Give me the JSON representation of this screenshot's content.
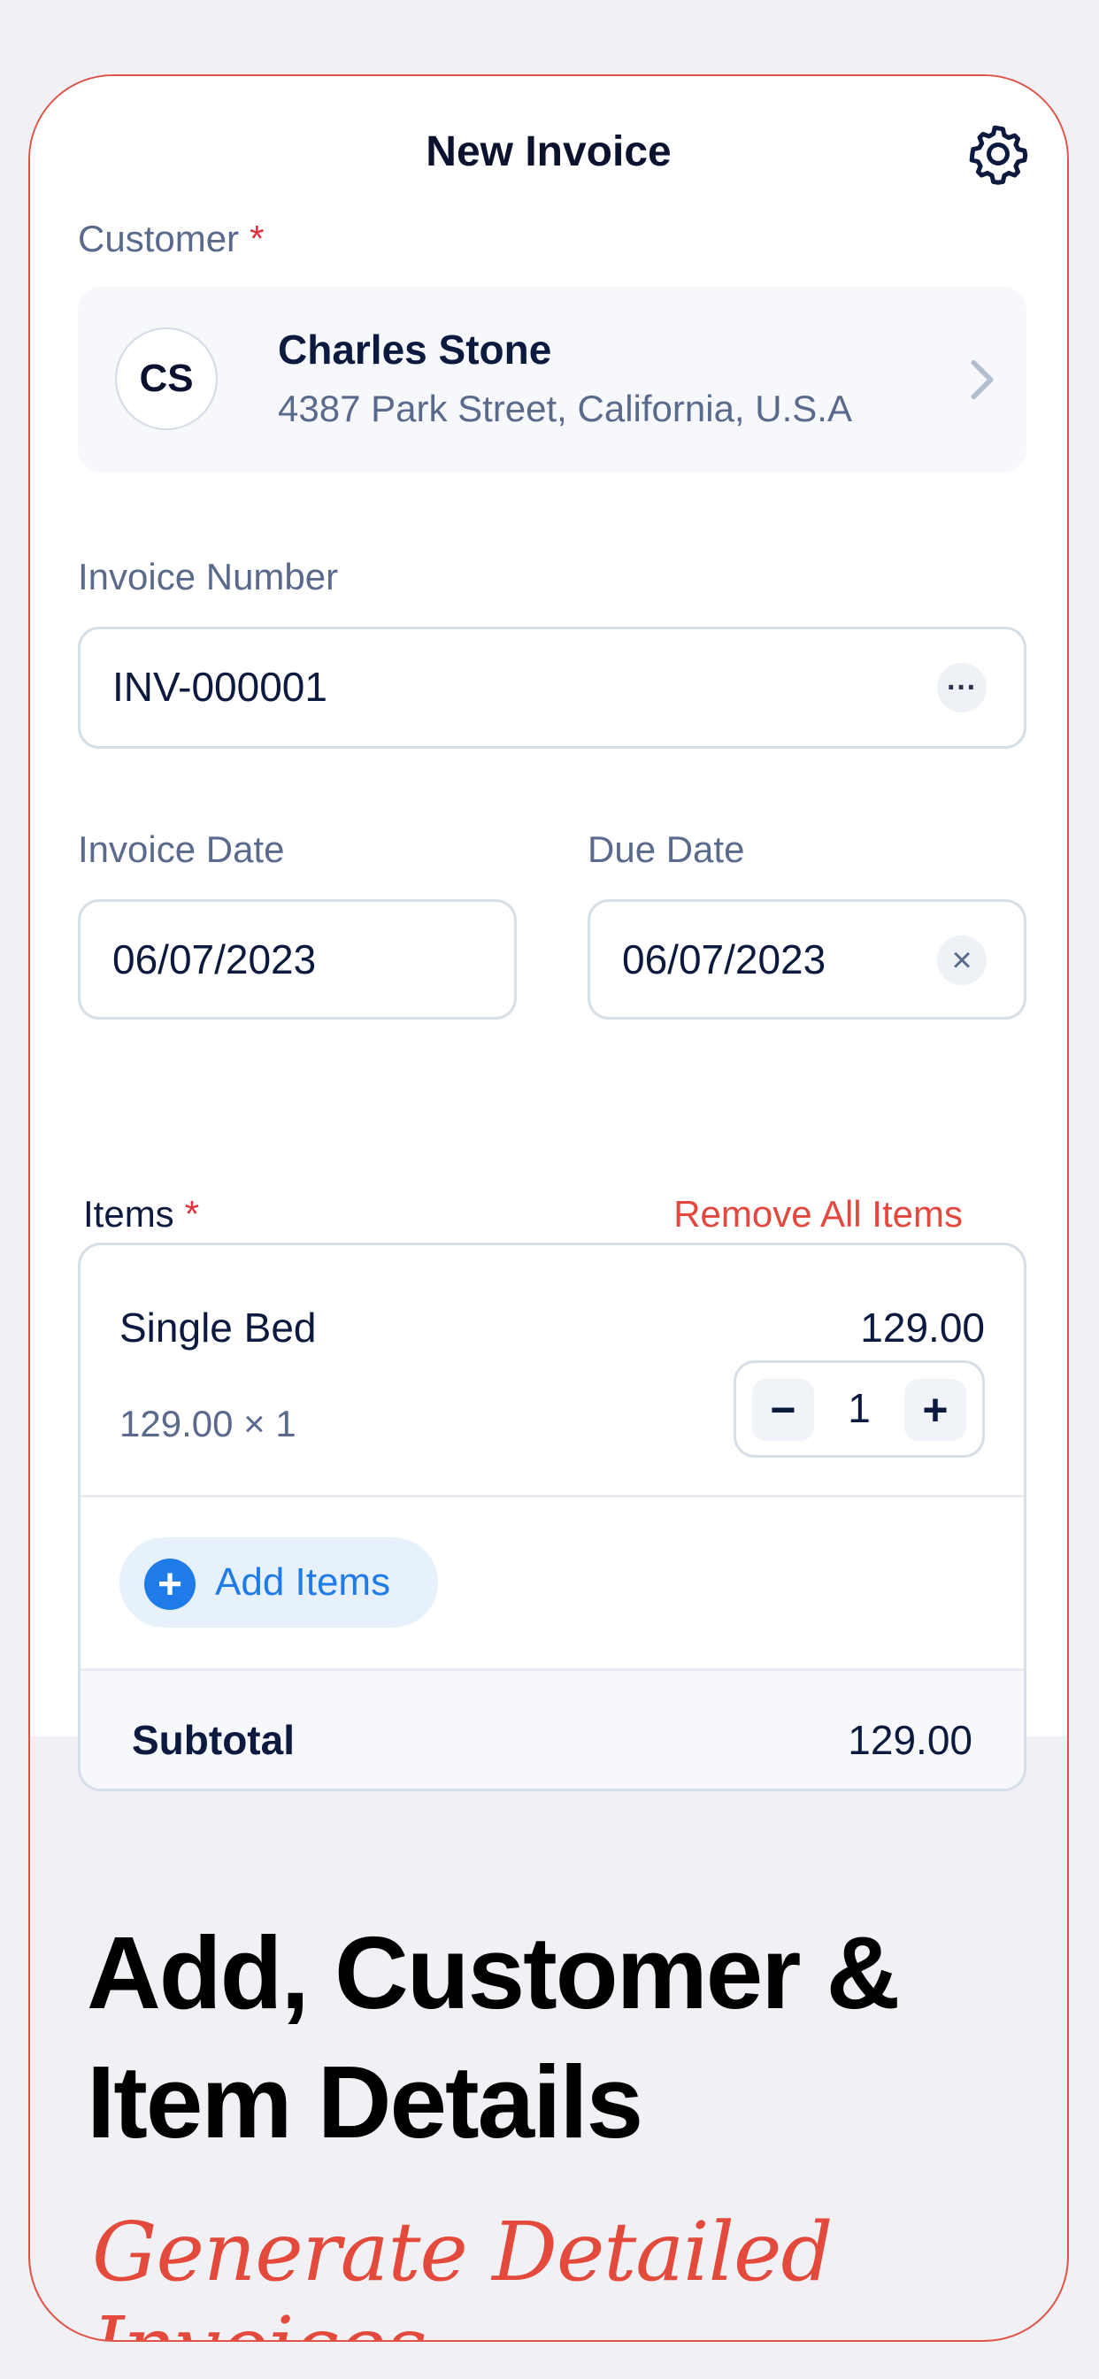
{
  "header": {
    "title": "New Invoice",
    "settings_icon": "gear-icon"
  },
  "customer": {
    "label": "Customer",
    "required_mark": "*",
    "initials": "CS",
    "name": "Charles Stone",
    "address": "4387 Park Street, California, U.S.A"
  },
  "invoice_number": {
    "label": "Invoice Number",
    "value": "INV-000001",
    "more_label": "···"
  },
  "invoice_date": {
    "label": "Invoice Date",
    "value": "06/07/2023"
  },
  "due_date": {
    "label": "Due Date",
    "value": "06/07/2023",
    "clear_label": "×"
  },
  "items": {
    "label": "Items",
    "required_mark": "*",
    "remove_all_label": "Remove All Items",
    "list": [
      {
        "name": "Single Bed",
        "price": "129.00",
        "detail": "129.00 × 1",
        "quantity": "1"
      }
    ],
    "minus_label": "−",
    "plus_label": "+",
    "add_icon": "+",
    "add_label": "Add Items",
    "subtotal_label": "Subtotal",
    "subtotal_value": "129.00"
  },
  "promo": {
    "headline_line1": "Add, Customer &",
    "headline_line2": "Item Details",
    "tagline": "Generate Detailed Invoices"
  },
  "colors": {
    "accent_blue": "#1f7be8",
    "danger_red": "#e3483f",
    "tagline_red": "#e34a3c",
    "tagline_orange": "#e88a4a"
  }
}
